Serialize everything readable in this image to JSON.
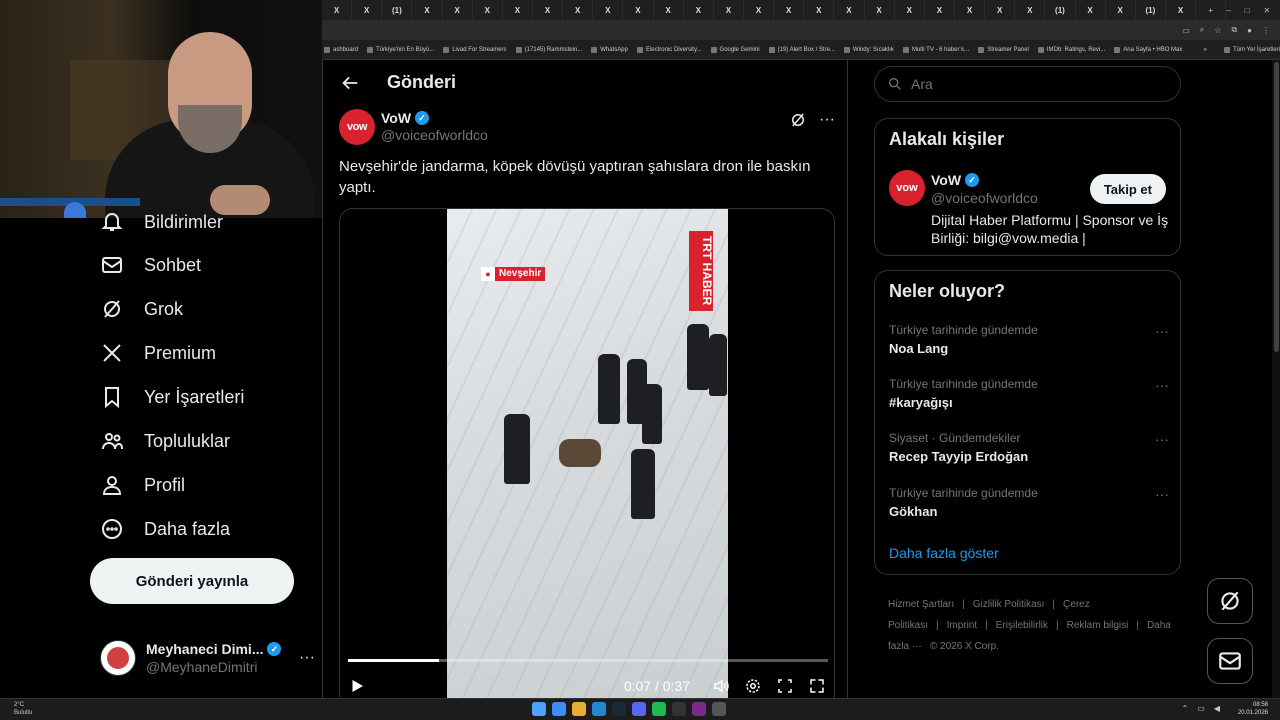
{
  "browser": {
    "tabs": [
      "X",
      "X",
      "(1)",
      "X",
      "X",
      "X",
      "X",
      "X",
      "X",
      "X",
      "X",
      "X",
      "X",
      "X",
      "X",
      "X",
      "X",
      "X",
      "X",
      "X",
      "X",
      "X",
      "X",
      "X",
      "(1)",
      "X",
      "X",
      "(1)",
      "X"
    ],
    "new_tab": "+",
    "bookmarks": [
      "ashboard",
      "Türkiye'nin En Büyü...",
      "Livad For Streamers",
      "(17145) Rammstein...",
      "WhatsApp",
      "Electronic Diversity...",
      "Google Gemini",
      "(19) Alert Box / Stre...",
      "Windy: Sıcaklık",
      "Multi TV - 6 haber k...",
      "Streamer Panel",
      "IMDb: Ratings, Revi...",
      "Ana Sayfa • HBO Max"
    ],
    "bookmarks_more": "»",
    "all_bookmarks": "Tüm Yer İşaretleri"
  },
  "nav": {
    "items": [
      {
        "label": "Bildirimler",
        "icon": "bell-icon"
      },
      {
        "label": "Sohbet",
        "icon": "mail-icon"
      },
      {
        "label": "Grok",
        "icon": "grok-icon"
      },
      {
        "label": "Premium",
        "icon": "x-logo-icon"
      },
      {
        "label": "Yer İşaretleri",
        "icon": "bookmark-icon"
      },
      {
        "label": "Topluluklar",
        "icon": "communities-icon"
      },
      {
        "label": "Profil",
        "icon": "profile-icon"
      },
      {
        "label": "Daha fazla",
        "icon": "more-circle-icon"
      }
    ],
    "post_button": "Gönderi yayınla",
    "account": {
      "name": "Meyhaneci Dimi...",
      "handle": "@MeyhaneDimitri",
      "more": "···"
    }
  },
  "main": {
    "title": "Gönderi",
    "author": {
      "avatar_text": "vow",
      "name": "VoW",
      "handle": "@voiceofworldco"
    },
    "text": "Nevşehir'de jandarma, köpek dövüşü yaptıran şahıslara dron ile baskın yaptı.",
    "video": {
      "location_tag": "Nevşehir",
      "channel_logo": "TRT HABER",
      "time": "0:07 / 0:37",
      "progress": 0.19
    }
  },
  "right": {
    "search_placeholder": "Ara",
    "related": {
      "title": "Alakalı kişiler",
      "avatar_text": "vow",
      "name": "VoW",
      "handle": "@voiceofworldco",
      "follow": "Takip et",
      "bio": "Dijital Haber Platformu | Sponsor ve İş Birliği: bilgi@vow.media |"
    },
    "trends": {
      "title": "Neler oluyor?",
      "items": [
        {
          "meta": "Türkiye tarihinde gündemde",
          "name": "Noa Lang"
        },
        {
          "meta": "Türkiye tarihinde gündemde",
          "name": "#karyağışı"
        },
        {
          "meta": "Siyaset · Gündemdekiler",
          "name": "Recep Tayyip Erdoğan"
        },
        {
          "meta": "Türkiye tarihinde gündemde",
          "name": "Gökhan"
        }
      ],
      "show_more": "Daha fazla göster"
    },
    "footer": [
      "Hizmet Şartları",
      "|",
      "Gizlilik Politikası",
      "|",
      "Çerez Politikası",
      "|",
      "Imprint",
      "|",
      "Erişilebilirlik",
      "|",
      "Reklam bilgisi",
      "|",
      "Daha fazla ···",
      "© 2026 X Corp."
    ]
  },
  "taskbar": {
    "weather_temp": "2°C",
    "weather_desc": "Bulutlu",
    "time": "08:58",
    "date": "20.01.2026"
  },
  "colors": {
    "accent": "#1d9bf0",
    "brand_red": "#d8232f",
    "bg": "#000000",
    "text": "#e7e9ea",
    "muted": "#71767b"
  }
}
